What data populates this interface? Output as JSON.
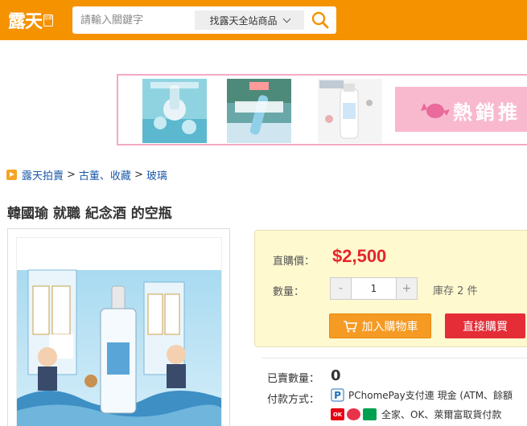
{
  "header": {
    "logo_text": "露天",
    "logo_badge": "拍賣",
    "search_placeholder": "請輸入關鍵字",
    "search_scope": "找露天全站商品"
  },
  "banner": {
    "hot_label": "熱銷推"
  },
  "breadcrumb": {
    "items": [
      "露天拍賣",
      "古董、收藏",
      "玻璃"
    ],
    "separator": ">"
  },
  "product": {
    "title": "韓國瑜 就職 紀念酒 的空瓶",
    "price_label": "直購價：",
    "price": "$2,500",
    "qty_label": "數量：",
    "qty_value": "1",
    "qty_minus": "-",
    "qty_plus": "+",
    "stock": "庫存 2 件",
    "add_to_cart": "加入購物車",
    "buy_now": "直接購買",
    "sold_label": "已賣數量：",
    "sold_value": "0",
    "payment_label": "付款方式：",
    "payment_line1": "PChomePay支付連 現金 (ATM、餘額",
    "payment_line2": "全家、OK、萊爾富取貨付款"
  },
  "colors": {
    "brand_orange": "#f59200",
    "price_red": "#e6252c",
    "cart_orange": "#f59a23",
    "buy_red": "#e42d37",
    "link_blue": "#1c5aa8",
    "price_box_bg": "#fff9cf"
  },
  "icons": [
    "search-icon",
    "chevron-down-icon",
    "breadcrumb-arrow-icon",
    "cart-icon",
    "pchomepay-icon",
    "ok-mart-icon",
    "hilife-icon",
    "familymart-icon"
  ]
}
